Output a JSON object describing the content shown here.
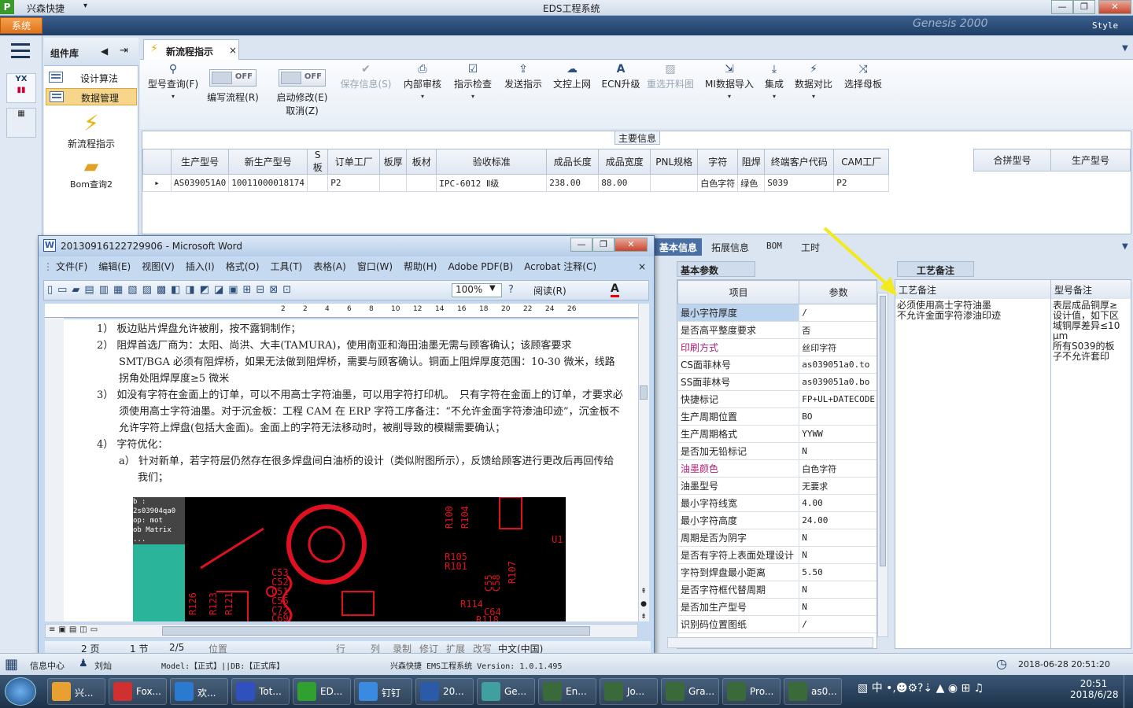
{
  "app": {
    "logo": "P",
    "name": "兴森快捷",
    "title": "EDS工程系统",
    "sys_menu": "系统",
    "style_label": "Style",
    "bg_deco": "Genesis 2000"
  },
  "winbtns": [
    "—",
    "❐",
    "✕"
  ],
  "complib": {
    "title": "组件库",
    "items": [
      "设计算法",
      "数据管理"
    ],
    "big_items": [
      "新流程指示",
      "Bom查询2"
    ]
  },
  "tab": {
    "label": "新流程指示"
  },
  "ribbon": {
    "buttons": [
      {
        "label": "型号查询(F)",
        "icon": "search-icon"
      },
      {
        "label": "保存信息(S)",
        "icon": "check-icon",
        "disabled": true
      },
      {
        "label": "内部审核",
        "icon": "print-icon"
      },
      {
        "label": "指示检查",
        "icon": "check-icon"
      },
      {
        "label": "发送指示",
        "icon": "upload-icon"
      },
      {
        "label": "文控上网",
        "icon": "cloud-icon"
      },
      {
        "label": "ECN升级",
        "icon": "a-icon"
      },
      {
        "label": "重选开料图",
        "icon": "image-icon",
        "disabled": true
      },
      {
        "label": "MI数据导入",
        "icon": "import-icon"
      },
      {
        "label": "集成",
        "icon": "download-icon"
      },
      {
        "label": "数据对比",
        "icon": "compare-icon"
      },
      {
        "label": "选择母板",
        "icon": "shuffle-icon"
      }
    ],
    "toggle1": {
      "state": "OFF",
      "label": "编写流程(R)"
    },
    "toggle2": {
      "state": "OFF",
      "label1": "启动修改(E)",
      "label2": "取消(Z)"
    }
  },
  "main_info": {
    "title": "主要信息",
    "columns": [
      "生产型号",
      "新生产型号",
      "S板",
      "订单工厂",
      "板厚",
      "板材",
      "验收标准",
      "成品长度",
      "成品宽度",
      "PNL规格",
      "字符",
      "阻焊",
      "终端客户代码",
      "CAM工厂"
    ],
    "row": [
      "AS039051A0",
      "10011000018174",
      "",
      "P2",
      "",
      "",
      "IPC-6012 Ⅱ级",
      "238.00",
      "88.00",
      "",
      "白色字符",
      "绿色",
      "S039",
      "P2"
    ],
    "side_columns": [
      "合拼型号",
      "生产型号"
    ]
  },
  "word": {
    "title": "20130916122729906 - Microsoft Word",
    "menu": [
      "文件(F)",
      "编辑(E)",
      "视图(V)",
      "插入(I)",
      "格式(O)",
      "工具(T)",
      "表格(A)",
      "窗口(W)",
      "帮助(H)",
      "Adobe PDF(B)",
      "Acrobat 注释(C)"
    ],
    "zoom": "100%",
    "read_btn": "阅读(R)",
    "ruler_ticks": [
      "2",
      "2",
      "4",
      "6",
      "8",
      "10",
      "12",
      "14",
      "16",
      "18",
      "20",
      "22",
      "24",
      "26"
    ],
    "paras": [
      "1） 板边贴片焊盘允许被削，按不露铜制作；",
      "2） 阻焊首选厂商为：太阳、尚洪、大丰(TAMURA)，使用南亚和海田油墨无需与顾客确认；该顾客要求 SMT/BGA 必须有阻焊桥，如果无法做到阻焊桥，需要与顾客确认。铜面上阻焊厚度范围：10-30 微米，线路拐角处阻焊厚度≥5 微米",
      "3） 如没有字符在金面上的订单，可以不用高士字符油墨，可以用字符打印机。　只有字符在金面上的订单，才要求必须使用高士字符油墨。对于沉金板：工程 CAM 在 ERP 字符工序备注：“不允许金面字符渗油印迹”，沉金板不允许字符上焊盘(包括大金面)。金面上的字符无法移动时，被削导致的模糊需要确认；",
      "4） 字符优化：",
      "a） 针对新单，若字符层仍然存在很多焊盘间白油桥的设计（类似附图所示），反馈给顾客进行更改后再回传给我们；"
    ],
    "pcb_labels": [
      "R105",
      "R101",
      "C53",
      "C52",
      "C51",
      "C56",
      "C72",
      "C69",
      "R114",
      "C64",
      "R118",
      "R100",
      "R104",
      "U1",
      "R123",
      "R121",
      "R126",
      "C55",
      "C58",
      "R107"
    ],
    "side_panel": [
      "b : 2s03904qa0",
      "op: mot",
      "ob Matrix ..."
    ],
    "status": {
      "page": "2 页",
      "section": "1 节",
      "pages": "2/5",
      "pos": "位置",
      "line": "行",
      "col": "列",
      "rec": "录制",
      "rev": "修订",
      "ext": "扩展",
      "ovr": "改写",
      "lang": "中文(中国)"
    }
  },
  "detail_tabs": [
    "基本信息",
    "拓展信息",
    "BOM",
    "工时"
  ],
  "params": {
    "title": "基本参数",
    "col_item": "项目",
    "col_val": "参数",
    "rows": [
      {
        "k": "最小字符厚度",
        "v": "/",
        "sel": true
      },
      {
        "k": "是否高平整度要求",
        "v": "否"
      },
      {
        "k": "印刷方式",
        "v": "丝印字符",
        "pink": true
      },
      {
        "k": "CS面菲林号",
        "v": "as039051a0.to"
      },
      {
        "k": "SS面菲林号",
        "v": "as039051a0.bo"
      },
      {
        "k": "快捷标记",
        "v": "FP+UL+DATECODE"
      },
      {
        "k": "生产周期位置",
        "v": "BO"
      },
      {
        "k": "生产周期格式",
        "v": "YYWW"
      },
      {
        "k": "是否加无铅标记",
        "v": "N"
      },
      {
        "k": "油墨颜色",
        "v": "白色字符",
        "pink": true
      },
      {
        "k": "油墨型号",
        "v": "无要求"
      },
      {
        "k": "最小字符线宽",
        "v": "4.00"
      },
      {
        "k": "最小字符高度",
        "v": "24.00"
      },
      {
        "k": "周期是否为阴字",
        "v": "N"
      },
      {
        "k": "是否有字符上表面处理设计",
        "v": "N"
      },
      {
        "k": "字符到焊盘最小距离",
        "v": "5.50"
      },
      {
        "k": "是否字符框代替周期",
        "v": "N"
      },
      {
        "k": "是否加生产型号",
        "v": "N"
      },
      {
        "k": "识别码位置图纸",
        "v": "/"
      }
    ]
  },
  "notes": {
    "title": "工艺备注",
    "col1": "工艺备注",
    "col2": "型号备注",
    "text1": "必须使用高士字符油墨\n不允许金面字符渗油印迹",
    "text2": "表层成品铜厚≥设计值，如下区域铜厚差异≤10μm\n所有S039的板子不允许套印"
  },
  "status": {
    "info": "信息中心",
    "user": "刘灿",
    "model": "Model:【正式】||DB:【正式库】",
    "company": "兴森快捷 EMS工程系统 Version: 1.0.1.495",
    "datetime": "2018-06-28 20:51:20"
  },
  "taskbar": {
    "items": [
      {
        "label": "兴...",
        "color": "#e8a030"
      },
      {
        "label": "Fox...",
        "color": "#d03030"
      },
      {
        "label": "欢...",
        "color": "#2a7ad0"
      },
      {
        "label": "Tot...",
        "color": "#3050c0"
      },
      {
        "label": "ED...",
        "color": "#30a030"
      },
      {
        "label": "钉钉",
        "color": "#3a8ae0"
      },
      {
        "label": "20...",
        "color": "#2b5aa8"
      },
      {
        "label": "Ge...",
        "color": "#40a0a0"
      },
      {
        "label": "En...",
        "color": "#3a6a3a"
      },
      {
        "label": "Jo...",
        "color": "#3a6a3a"
      },
      {
        "label": "Gra...",
        "color": "#3a6a3a"
      },
      {
        "label": "Pro...",
        "color": "#3a6a3a"
      },
      {
        "label": "as0...",
        "color": "#3a6a3a"
      }
    ],
    "tray_ime": "中",
    "time": "20:51",
    "date": "2018/6/28"
  }
}
